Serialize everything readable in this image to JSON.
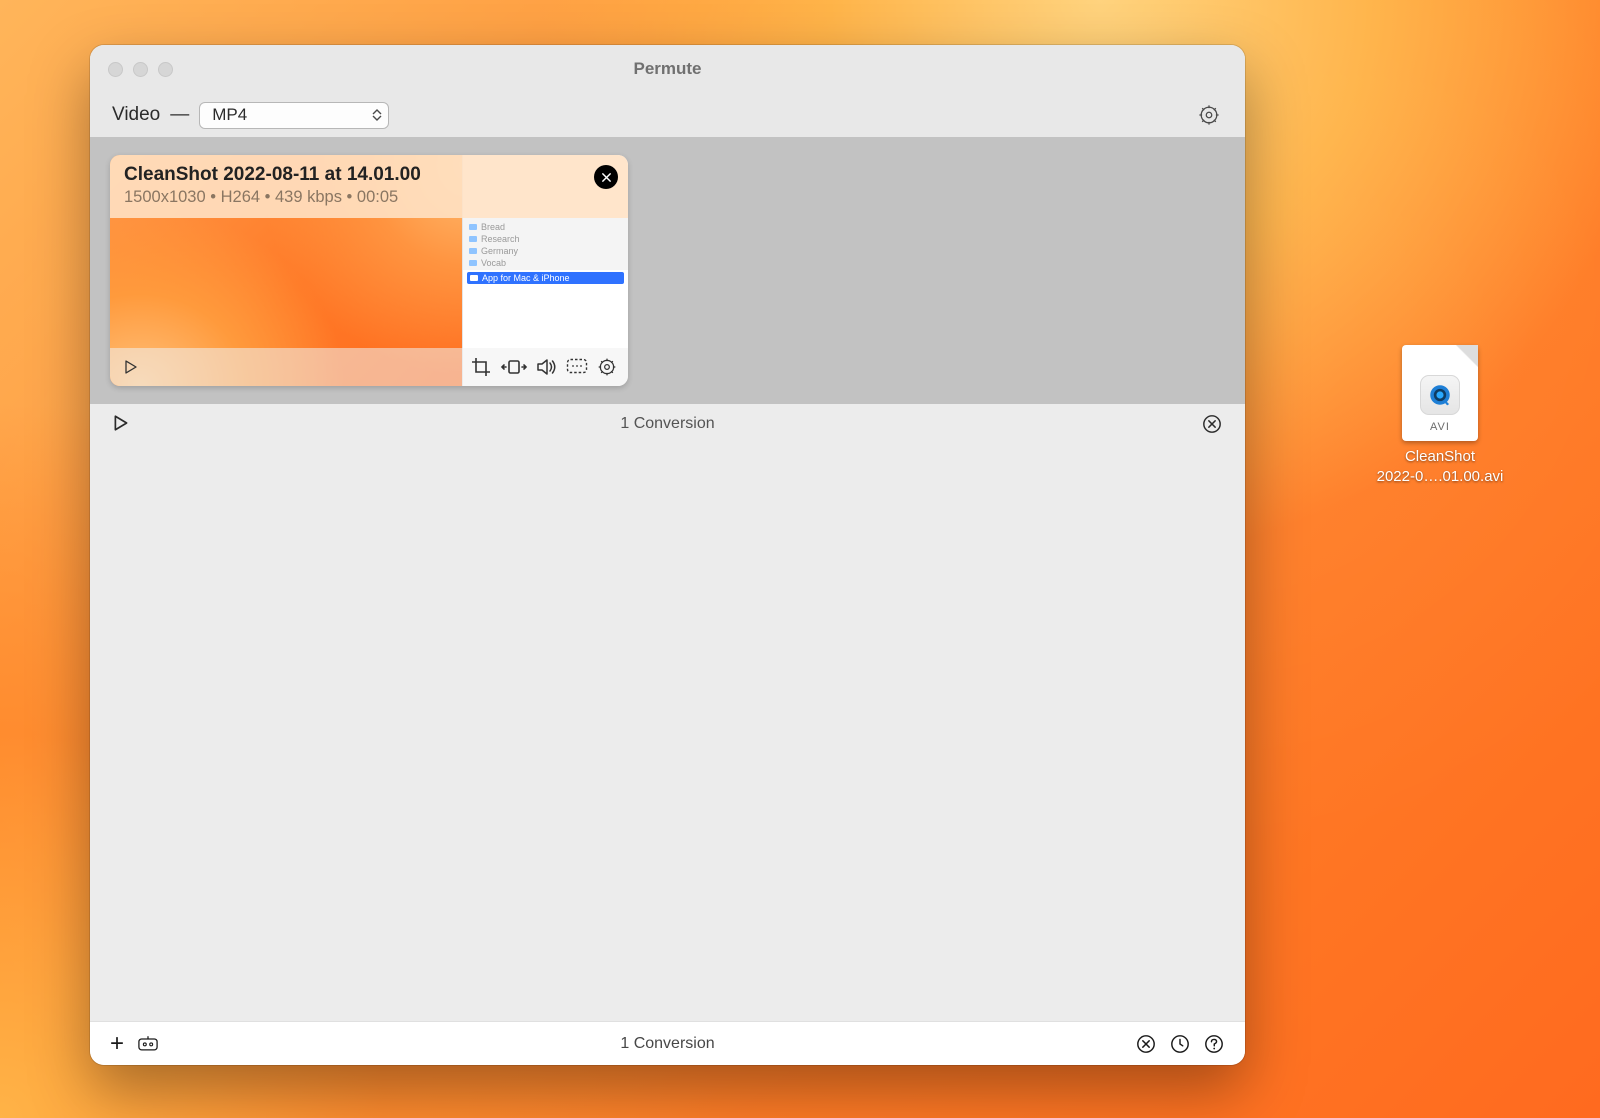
{
  "window": {
    "title": "Permute"
  },
  "toolbar": {
    "category_label": "Video",
    "dash": "—",
    "format_selected": "MP4"
  },
  "video": {
    "title": "CleanShot 2022-08-11 at 14.01.00",
    "meta": "1500x1030 • H264 • 439 kbps • 00:05",
    "finder_rows": [
      "Bread",
      "Research",
      "Germany",
      "Vocab"
    ],
    "finder_highlight": "App for Mac & iPhone"
  },
  "status": {
    "text_mid": "1 Conversion",
    "text_footer": "1 Conversion"
  },
  "desktop_file": {
    "ext_label": "AVI",
    "filename_line1": "CleanShot",
    "filename_line2": "2022-0….01.00.avi"
  }
}
